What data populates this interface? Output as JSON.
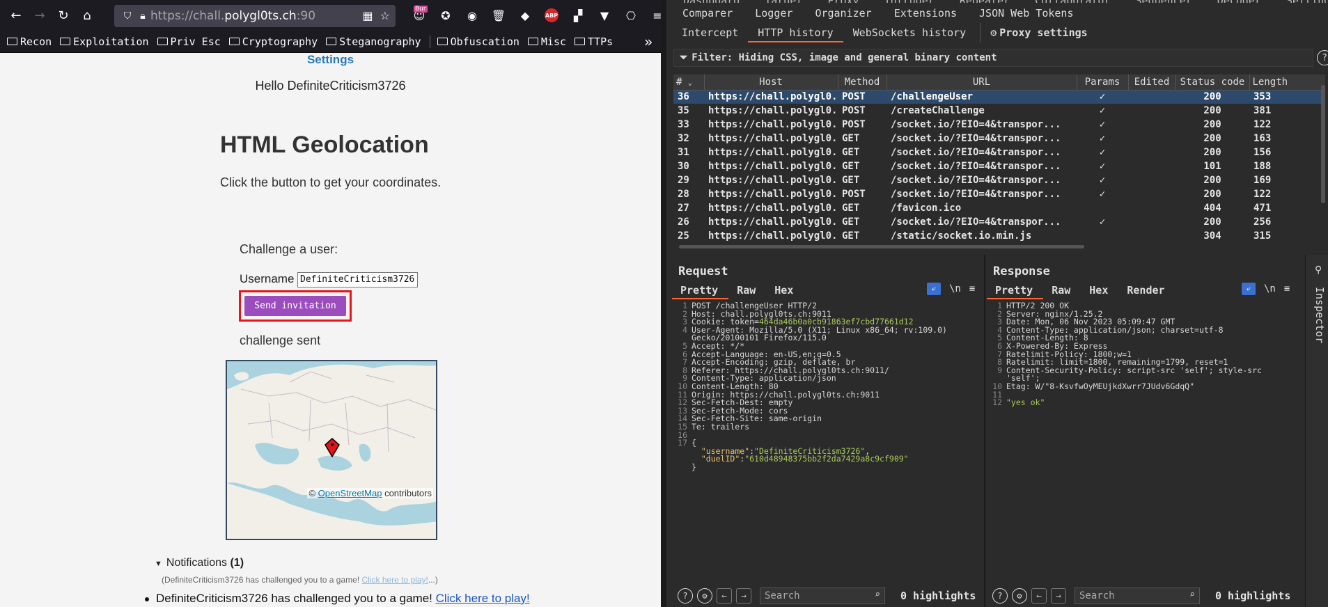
{
  "browser": {
    "url_scheme": "https://",
    "url_host_pre": "chall.",
    "url_host": "polygl0ts.ch",
    "url_rest": ":90",
    "ext_badge": "Bur",
    "abp": "ABP",
    "bookmarks": [
      "Recon",
      "Exploitation",
      "Priv Esc",
      "Cryptography",
      "Steganography",
      "Obfuscation",
      "Misc",
      "TTPs"
    ]
  },
  "page": {
    "settings_link": "Settings",
    "hello": "Hello DefiniteCriticism3726",
    "title": "HTML Geolocation",
    "subtitle": "Click the button to get your coordinates.",
    "challenge_label": "Challenge a user:",
    "username_label": "Username",
    "username_value": "DefiniteCriticism3726",
    "send_label": "Send invitation",
    "sent_msg": "challenge sent",
    "map_attr_prefix": "© ",
    "map_attr_link": "OpenStreetMap",
    "map_attr_suffix": " contributors",
    "notifications_label": "Notifications",
    "notifications_count": "(1)",
    "notif_small_text": "(DefiniteCriticism3726 has challenged you to a game! ",
    "notif_small_link": "Click here to play!",
    "notif_small_end": "...)",
    "notif_text": "DefiniteCriticism3726 has challenged you to a game! ",
    "notif_link": "Click here to play!"
  },
  "burp": {
    "tabs_top_cut": [
      "Dashboard",
      "Target",
      "Proxy",
      "Intruder",
      "Repeater",
      "Collaborator",
      "Sequencer",
      "Decoder",
      "Settings"
    ],
    "tabs_row1": [
      "Comparer",
      "Logger",
      "Organizer",
      "Extensions",
      "JSON Web Tokens"
    ],
    "tabs_row2": [
      "Intercept",
      "HTTP history",
      "WebSockets history"
    ],
    "proxy_settings": "Proxy settings",
    "filter": "Filter: Hiding CSS, image and general binary content",
    "columns": [
      "#",
      "Host",
      "Method",
      "URL",
      "Params",
      "Edited",
      "Status code",
      "Length"
    ],
    "rows": [
      {
        "n": "36",
        "host": "https://chall.polygl0...",
        "method": "POST",
        "url": "/challengeUser",
        "params": "✓",
        "status": "200",
        "len": "353"
      },
      {
        "n": "35",
        "host": "https://chall.polygl0...",
        "method": "POST",
        "url": "/createChallenge",
        "params": "✓",
        "status": "200",
        "len": "381"
      },
      {
        "n": "33",
        "host": "https://chall.polygl0...",
        "method": "POST",
        "url": "/socket.io/?EIO=4&transpor...",
        "params": "✓",
        "status": "200",
        "len": "122"
      },
      {
        "n": "32",
        "host": "https://chall.polygl0...",
        "method": "GET",
        "url": "/socket.io/?EIO=4&transpor...",
        "params": "✓",
        "status": "200",
        "len": "163"
      },
      {
        "n": "31",
        "host": "https://chall.polygl0...",
        "method": "GET",
        "url": "/socket.io/?EIO=4&transpor...",
        "params": "✓",
        "status": "200",
        "len": "156"
      },
      {
        "n": "30",
        "host": "https://chall.polygl0...",
        "method": "GET",
        "url": "/socket.io/?EIO=4&transpor...",
        "params": "✓",
        "status": "101",
        "len": "188"
      },
      {
        "n": "29",
        "host": "https://chall.polygl0...",
        "method": "GET",
        "url": "/socket.io/?EIO=4&transpor...",
        "params": "✓",
        "status": "200",
        "len": "169"
      },
      {
        "n": "28",
        "host": "https://chall.polygl0...",
        "method": "POST",
        "url": "/socket.io/?EIO=4&transpor...",
        "params": "✓",
        "status": "200",
        "len": "122"
      },
      {
        "n": "27",
        "host": "https://chall.polygl0...",
        "method": "GET",
        "url": "/favicon.ico",
        "params": "",
        "status": "404",
        "len": "471"
      },
      {
        "n": "26",
        "host": "https://chall.polygl0...",
        "method": "GET",
        "url": "/socket.io/?EIO=4&transpor...",
        "params": "✓",
        "status": "200",
        "len": "256"
      },
      {
        "n": "25",
        "host": "https://chall.polygl0...",
        "method": "GET",
        "url": "/static/socket.io.min.js",
        "params": "",
        "status": "304",
        "len": "315"
      }
    ],
    "request": {
      "title": "Request",
      "tabs": [
        "Pretty",
        "Raw",
        "Hex"
      ],
      "lines": [
        "POST /challengeUser HTTP/2",
        "Host: chall.polygl0ts.ch:9011",
        "Cookie: token=",
        "User-Agent: Mozilla/5.0 (X11; Linux x86_64; rv:109.0)",
        "Accept: */*",
        "Accept-Language: en-US,en;q=0.5",
        "Accept-Encoding: gzip, deflate, br",
        "Referer: https://chall.polygl0ts.ch:9011/",
        "Content-Type: application/json",
        "Content-Length: 80",
        "Origin: https://chall.polygl0ts.ch:9011",
        "Sec-Fetch-Dest: empty",
        "Sec-Fetch-Mode: cors",
        "Sec-Fetch-Site: same-origin",
        "Te: trailers",
        "",
        "{"
      ],
      "cookie_value": "464da46b0a0cb91863ef7cbd77661d12",
      "ua_cont": "Gecko/20100101 Firefox/115.0",
      "json_k1": "\"username\"",
      "json_v1": "\"DefiniteCriticism3726\"",
      "json_k2": "\"duelID\"",
      "json_v2": "\"610d48948375bb2f2da7429a8c9cf909\"",
      "close": "}"
    },
    "response": {
      "title": "Response",
      "tabs": [
        "Pretty",
        "Raw",
        "Hex",
        "Render"
      ],
      "lines": [
        "HTTP/2 200 OK",
        "Server: nginx/1.25.2",
        "Date: Mon, 06 Nov 2023 05:09:47 GMT",
        "Content-Type: application/json; charset=utf-8",
        "Content-Length: 8",
        "X-Powered-By: Express",
        "Ratelimit-Policy: 1800;w=1",
        "Ratelimit: limit=1800, remaining=1799, reset=1",
        "Content-Security-Policy: script-src 'self'; style-src",
        "Etag: W/\"8-KsvfwOyMEUjkdXwrr7JUdv6GdqQ\"",
        "",
        "\"yes ok\""
      ],
      "csp_cont": "'self';"
    },
    "search_placeholder": "Search",
    "highlights": "0 highlights",
    "inspector": "Inspector"
  },
  "colors": {
    "accent": "#ff6633",
    "send_button": "#9b4dbd",
    "highlight_box": "#e8141b",
    "selected_row": "#2d4a6d"
  }
}
